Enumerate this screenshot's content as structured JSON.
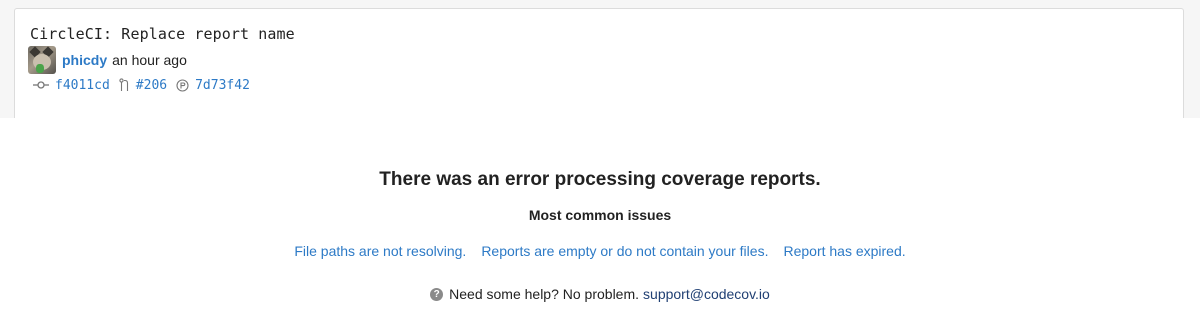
{
  "commit": {
    "title": "CircleCI: Replace report name",
    "author": "phicdy",
    "time_ago": "an hour ago",
    "commit_sha": "f4011cd",
    "pull_request": "#206",
    "base_sha": "7d73f42"
  },
  "error": {
    "title": "There was an error processing coverage reports.",
    "issues_heading": "Most common issues",
    "issues": [
      "File paths are not resolving.",
      "Reports are empty or do not contain your files.",
      "Report has expired."
    ],
    "help_text": "Need some help? No problem.",
    "help_email": "support@codecov.io"
  },
  "icons": {
    "commit": "commit-icon",
    "pull_request": "pull-request-icon",
    "base": "base-commit-icon",
    "help": "question-icon"
  },
  "colors": {
    "link": "#2d7ac6",
    "email": "#1f3f73",
    "text": "#222222"
  }
}
